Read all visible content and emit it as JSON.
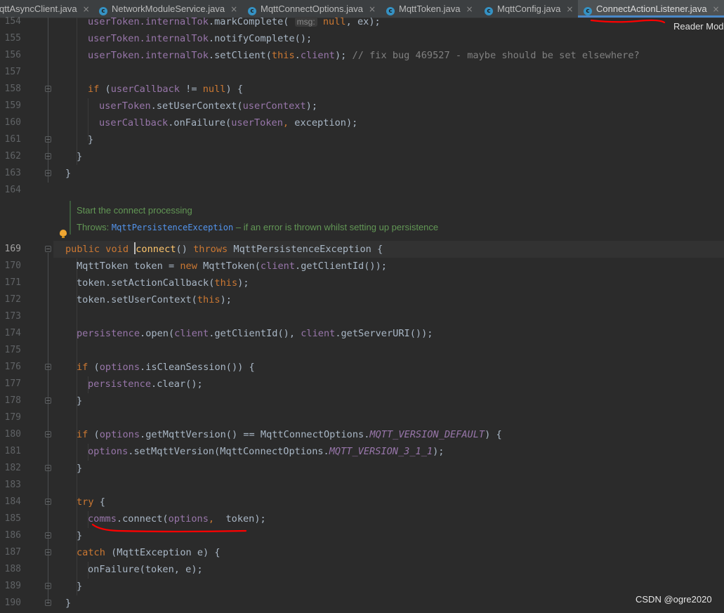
{
  "tabs": [
    {
      "label": "qttAsyncClient.java",
      "icon": "java-class-icon",
      "active": false
    },
    {
      "label": "NetworkModuleService.java",
      "icon": "java-class-icon",
      "active": false
    },
    {
      "label": "MqttConnectOptions.java",
      "icon": "java-class-icon",
      "active": false
    },
    {
      "label": "MqttToken.java",
      "icon": "java-class-icon",
      "active": false
    },
    {
      "label": "MqttConfig.java",
      "icon": "java-class-icon",
      "active": false
    },
    {
      "label": "ConnectActionListener.java",
      "icon": "java-class-icon",
      "active": true
    }
  ],
  "tab_icon_glyph": "c",
  "tab_close_glyph": "×",
  "reader_mode": "Reader Mod",
  "line_numbers": {
    "n154": "154",
    "n155": "155",
    "n156": "156",
    "n157": "157",
    "n158": "158",
    "n159": "159",
    "n160": "160",
    "n161": "161",
    "n162": "162",
    "n163": "163",
    "n164": "164",
    "n169": "169",
    "n170": "170",
    "n171": "171",
    "n172": "172",
    "n173": "173",
    "n174": "174",
    "n175": "175",
    "n176": "176",
    "n177": "177",
    "n178": "178",
    "n179": "179",
    "n180": "180",
    "n181": "181",
    "n182": "182",
    "n183": "183",
    "n184": "184",
    "n185": "185",
    "n186": "186",
    "n187": "187",
    "n188": "188",
    "n189": "189",
    "n190": "190"
  },
  "code": {
    "userToken": "userToken",
    "userCallback": "userCallback",
    "userContext": "userContext",
    "internalTok": ".internalTok",
    "markComplete": ".markComplete(",
    "msg_hint": "msg:",
    "null_kw": "null",
    "ex_arg": ", ex);",
    "notifyComplete": ".notifyComplete();",
    "setClient": ".setClient(",
    "this_kw": "this",
    "client_field": "client",
    "close_semi": ");",
    "fix_comment": " // fix bug 469527 - maybe should be set elsewhere?",
    "if_kw": "if",
    "neq_null_open": " != ",
    "open_paren": " (",
    "close_brace_open": ") {",
    "setUserContext": ".setUserContext(",
    "onFailure": ".onFailure(",
    "exception_arg": "exception);",
    "comma_space": ", ",
    "close_brace": "}",
    "public_kw": "public",
    "void_kw": "void",
    "connect_name": "connect",
    "throws_kw": "throws",
    "paren_empty": "() ",
    "mqtt_persist_ex": " MqttPersistenceException {",
    "l170_a": "MqttToken token = ",
    "new_kw": "new",
    "l170_b": " MqttToken(",
    "getClientId": ".getClientId());",
    "l171": "token.setActionCallback(",
    "l172": "token.setUserContext(",
    "persistence": "persistence",
    "open_call": ".open(",
    "getClientId2": ".getClientId(), ",
    "getServerURI": ".getServerURI());",
    "options": "options",
    "isCleanSession": ".isCleanSession()) {",
    "clear_call": ".clear();",
    "getMqttVersion": ".getMqttVersion() == MqttConnectOptions.",
    "ver_default": "MQTT_VERSION_DEFAULT",
    "setMqttVersion": ".setMqttVersion(MqttConnectOptions.",
    "ver_311": "MQTT_VERSION_3_1_1",
    "try_kw": "try",
    "brace_open": " {",
    "comms": "comms",
    "connect_call": ".connect(",
    "token_close": " token);",
    "catch_kw": "catch",
    "catch_rest": " (MqttException e) {",
    "onFailure_local": "onFailure(token, e);"
  },
  "doc": {
    "summary": "Start the connect processing",
    "throws_label": "Throws: ",
    "throws_exception": "MqttPersistenceException",
    "throws_desc": " – if an error is thrown whilst setting up persistence"
  },
  "colors": {
    "background": "#2b2b2b",
    "keyword": "#cc7832",
    "field": "#9876aa",
    "comment": "#808080",
    "doc": "#629755",
    "annotation_red": "#ff0000",
    "active_tab_underline": "#4a88c7"
  },
  "watermark": "CSDN @ogre2020"
}
